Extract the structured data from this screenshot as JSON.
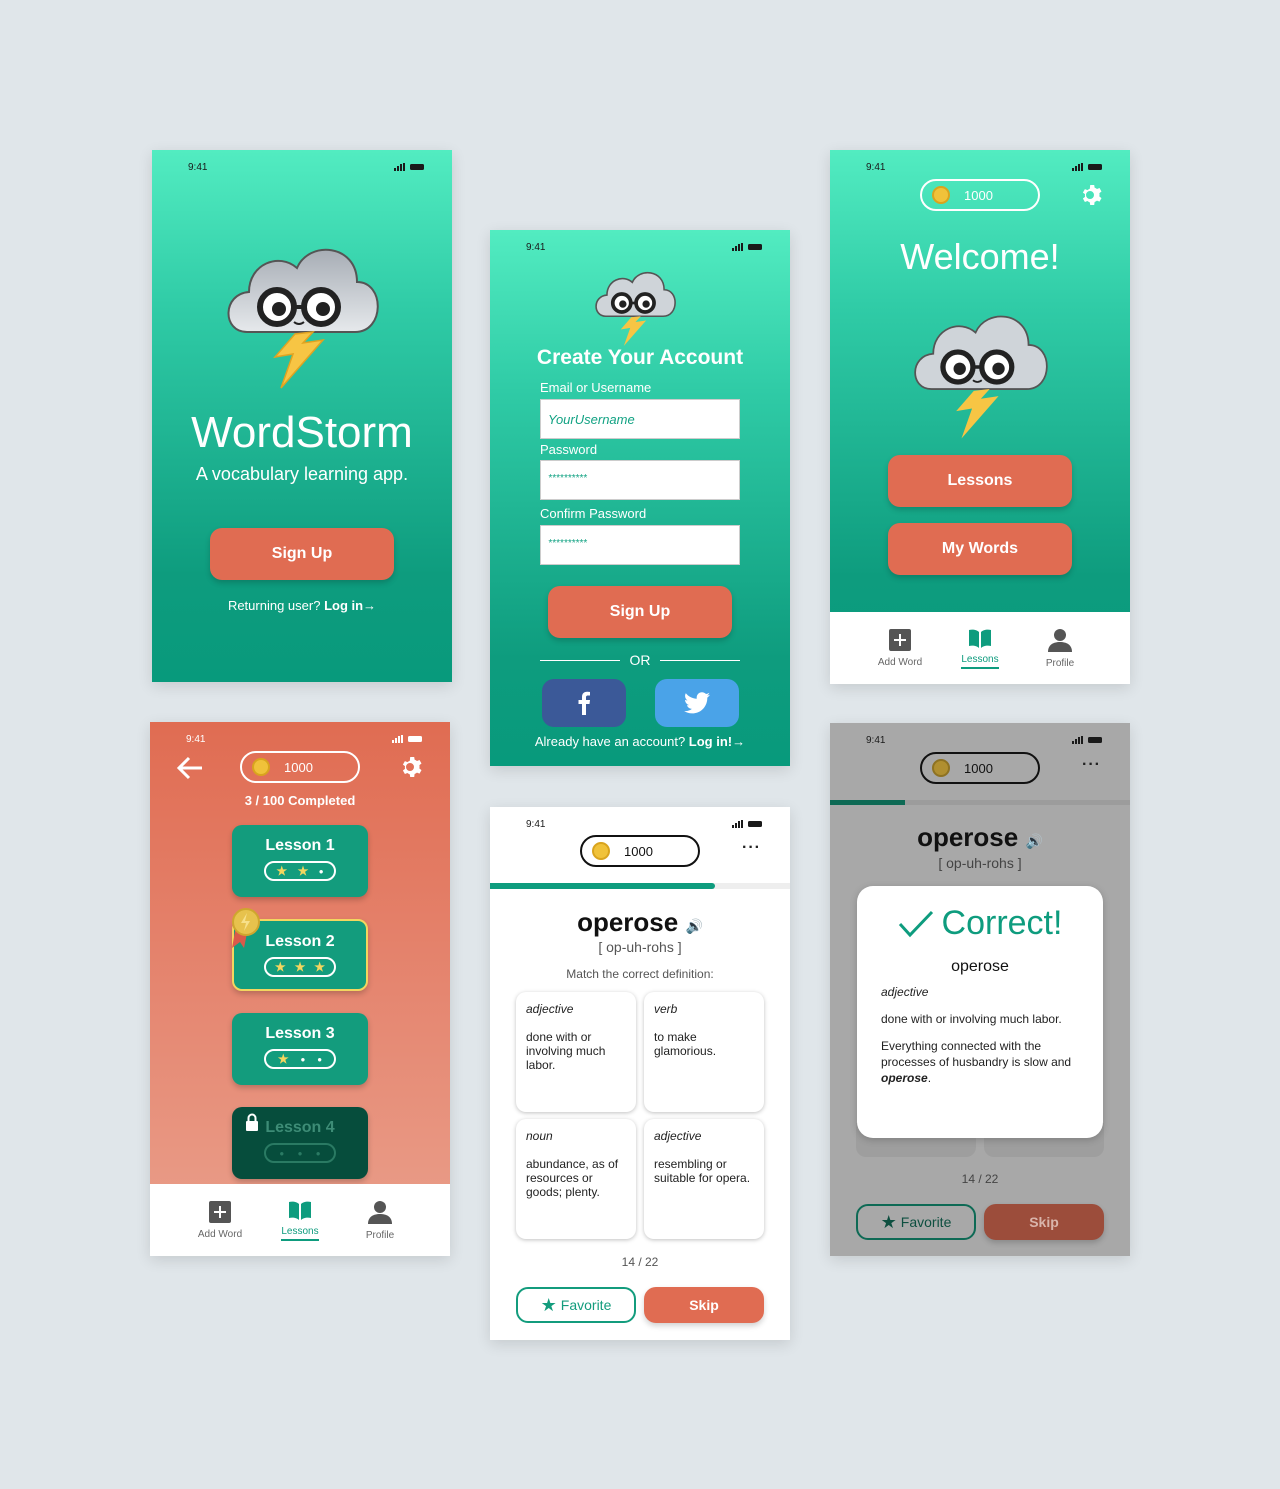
{
  "status": {
    "time": "9:41"
  },
  "coins": "1000",
  "splash": {
    "title": "WordStorm",
    "subtitle": "A vocabulary learning app.",
    "signup": "Sign Up",
    "returning_prefix": "Returning user? ",
    "returning_link": "Log in→"
  },
  "signup_screen": {
    "title": "Create Your Account",
    "email_label": "Email or Username",
    "email_value": "YourUsername",
    "password_label": "Password",
    "password_value": "**********",
    "confirm_label": "Confirm Password",
    "confirm_value": "**********",
    "signup": "Sign Up",
    "or": "OR",
    "already_prefix": "Already have an account? ",
    "already_link": "Log in!→"
  },
  "welcome": {
    "title": "Welcome!",
    "lessons": "Lessons",
    "my_words": "My Words"
  },
  "tabs": {
    "add_word": "Add Word",
    "lessons": "Lessons",
    "profile": "Profile"
  },
  "lessons_screen": {
    "completed": "3 / 100 Completed",
    "items": [
      {
        "label": "Lesson 1",
        "stars": 2
      },
      {
        "label": "Lesson 2",
        "stars": 3
      },
      {
        "label": "Lesson 3",
        "stars": 1
      },
      {
        "label": "Lesson 4",
        "stars": 0,
        "locked": true
      }
    ]
  },
  "quiz": {
    "word": "operose",
    "pronunciation": "[ op-uh-rohs ]",
    "instruction": "Match the correct definition:",
    "progress": 0.75,
    "options": [
      {
        "pos": "adjective",
        "def": "done with or involving much labor."
      },
      {
        "pos": "verb",
        "def": "to make glamorious."
      },
      {
        "pos": "noun",
        "def": "abundance, as of resources or goods; plenty."
      },
      {
        "pos": "adjective",
        "def": "resembling or suitable for opera."
      }
    ],
    "counter": "14 / 22",
    "favorite": "Favorite",
    "skip": "Skip"
  },
  "correct": {
    "title": "Correct!",
    "word": "operose",
    "pos": "adjective",
    "definition": "done with or involving much labor.",
    "example_before": "Everything connected with the processes of husbandry is slow and ",
    "example_word": "operose",
    "example_after": ".",
    "progress": 0.25
  },
  "colors": {
    "teal": "#0e9c7e",
    "mint": "#52ecc1",
    "coral": "#e06c52",
    "facebook": "#3b5998",
    "twitter": "#4aa3e8"
  }
}
